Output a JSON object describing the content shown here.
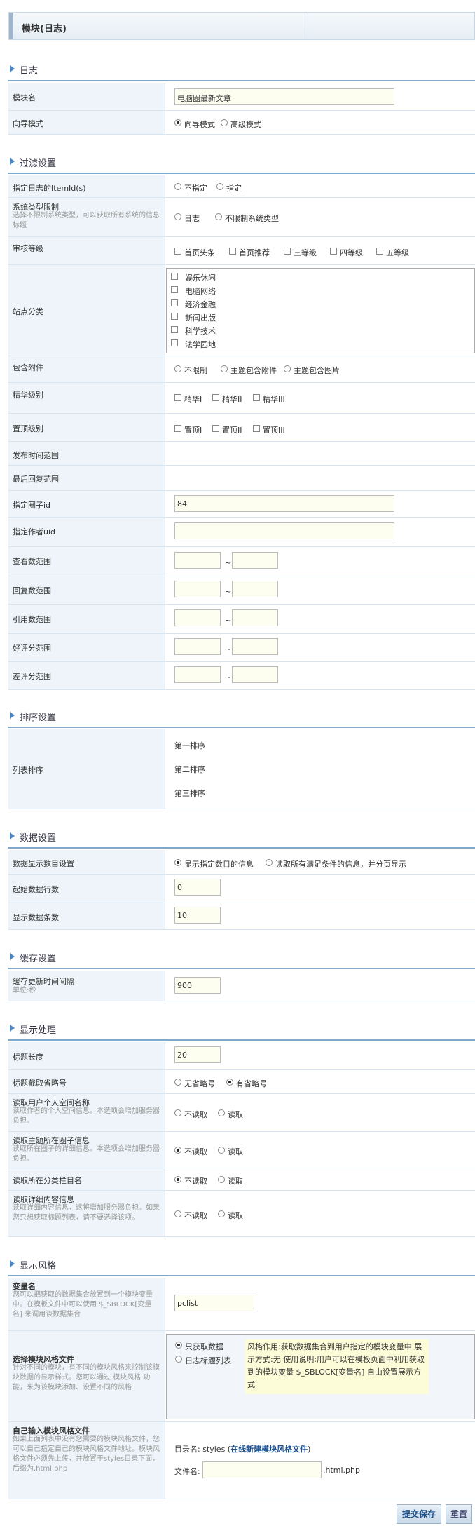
{
  "page_title": "模块(日志)",
  "sections": {
    "log": "日志",
    "filter": "过滤设置",
    "sort": "排序设置",
    "data": "数据设置",
    "cache": "缓存设置",
    "display": "显示处理",
    "style": "显示风格"
  },
  "log": {
    "module_name_label": "模块名",
    "module_name_value": "电脑圈最新文章",
    "wizard_label": "向导模式",
    "wizard_opt1": "向导模式",
    "wizard_opt2": "高级模式"
  },
  "filter": {
    "itemid_label": "指定日志的ItemId(s)",
    "itemid_opt1": "不指定",
    "itemid_opt2": "指定",
    "systype_label": "系统类型限制",
    "systype_sub": "选择不限制系统类型，可以获取所有系统的信息标题",
    "systype_opt1": "日志",
    "systype_opt2": "不限制系统类型",
    "grade_label": "审核等级",
    "grades": [
      "首页头条",
      "首页推荐",
      "三等级",
      "四等级",
      "五等级"
    ],
    "site_label": "站点分类",
    "site_items": [
      "娱乐休闲",
      "电脑网络",
      "经济金融",
      "新闻出版",
      "科学技术",
      "法学园地"
    ],
    "attach_label": "包含附件",
    "attach_opts": [
      "不限制",
      "主题包含附件",
      "主题包含图片"
    ],
    "digest_label": "精华级别",
    "digest_opts": [
      "精华I",
      "精华II",
      "精华III"
    ],
    "top_label": "置顶级别",
    "top_opts": [
      "置顶I",
      "置顶II",
      "置顶III"
    ],
    "posttime_label": "发布时间范围",
    "lastreply_label": "最后回复范围",
    "circle_label": "指定圈子id",
    "circle_value": "84",
    "author_label": "指定作者uid",
    "author_value": "",
    "view_label": "查看数范围",
    "reply_label": "回复数范围",
    "quote_label": "引用数范围",
    "good_label": "好评分范围",
    "bad_label": "差评分范围",
    "tilde": "~"
  },
  "sort": {
    "label": "列表排序",
    "items": [
      "第一排序",
      "第二排序",
      "第三排序"
    ]
  },
  "data": {
    "mode_label": "数据显示数目设置",
    "mode_opt1": "显示指定数目的信息",
    "mode_opt2": "读取所有满足条件的信息，并分页显示",
    "start_label": "起始数据行数",
    "start_value": "0",
    "count_label": "显示数据条数",
    "count_value": "10"
  },
  "cache": {
    "label": "缓存更新时间间隔",
    "sub": "单位:秒",
    "value": "900"
  },
  "display": {
    "title_len_label": "标题长度",
    "title_len_value": "20",
    "ellipsis_label": "标题截取省略号",
    "ellipsis_opt1": "无省略号",
    "ellipsis_opt2": "有省略号",
    "space_label": "读取用户个人空间名称",
    "space_sub": "读取作者的个人空间信息。本选项会增加服务器负担。",
    "circle_info_label": "读取主题所在圈子信息",
    "circle_info_sub": "读取所在圈子的详细信息。本选项会增加服务器负担。",
    "category_label": "读取所在分类栏目名",
    "detail_label": "读取详细内容信息",
    "detail_sub": "读取详细内容信息，这将增加服务器负担。如果您只想获取标题列表，请不要选择该项。",
    "no_read": "不读取",
    "read": "读取"
  },
  "style": {
    "var_label": "变量名",
    "var_sub": "您可以把获取的数据集合放置到一个模块变量中。在模板文件中可以使用 $_SBLOCK[变量名] 来调用该数据集合",
    "var_value": "pclist",
    "choose_label": "选择模块风格文件",
    "choose_sub": "针对不同的模块，有不同的模块风格来控制该模块数据的显示样式。您可以通过 模块风格 功能，来为该模块添加、设置不同的风格",
    "opt1": "只获取数据",
    "opt2": "日志标题列表",
    "note": "风格作用:获取数据集合到用户指定的模块变量中 展示方式:无 使用说明:用户可以在模板页面中利用获取到的模块变量 $_SBLOCK[变量名] 自由设置展示方式",
    "custom_label": "自己输入模块风格文件",
    "custom_sub": "如果上面列表中没有您需要的模块风格文件，您可以自己指定自己的模块风格文件地址。模块风格文件必须先上传，并放置于styles目录下面，后缀为.html.php",
    "dir_prefix": "目录名: styles",
    "dir_link": "在线新建模块风格文件",
    "file_label": "文件名:",
    "file_suffix": ".html.php"
  },
  "buttons": {
    "submit": "提交保存",
    "reset": "重置"
  }
}
